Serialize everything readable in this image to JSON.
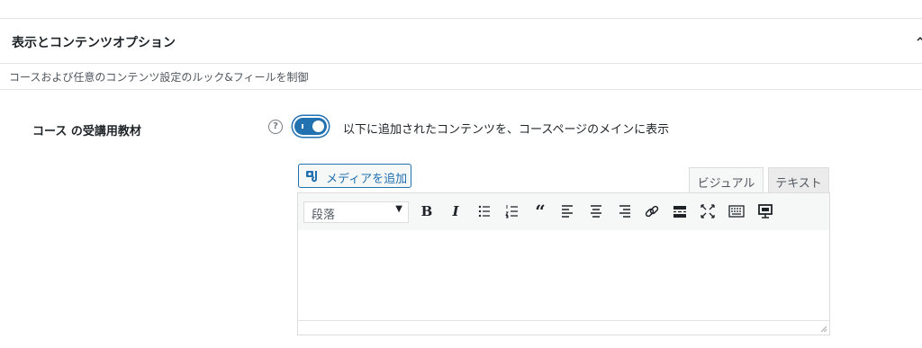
{
  "section": {
    "title": "表示とコンテンツオプション",
    "description": "コースおよび任意のコンテンツ設定のルック&フィールを制御"
  },
  "field": {
    "label": "コース の受講用教材",
    "help_glyph": "?",
    "toggle_on": true,
    "toggle_text": "以下に追加されたコンテンツを、コースページのメインに表示"
  },
  "editor": {
    "add_media_label": "メディアを追加",
    "tabs": [
      "ビジュアル",
      "テキスト"
    ],
    "active_tab": "ビジュアル",
    "format_select_value": "段落",
    "toolbar_icons": [
      "bold-icon",
      "italic-icon",
      "bullet-list-icon",
      "numbered-list-icon",
      "blockquote-icon",
      "align-left-icon",
      "align-center-icon",
      "align-right-icon",
      "link-icon",
      "read-more-icon",
      "fullscreen-icon",
      "toolbar-toggle-icon",
      "embed-icon"
    ],
    "content": ""
  },
  "colors": {
    "accent": "#2271b1",
    "border": "#dcdcde",
    "toolbar_bg": "#f6f7f7"
  }
}
